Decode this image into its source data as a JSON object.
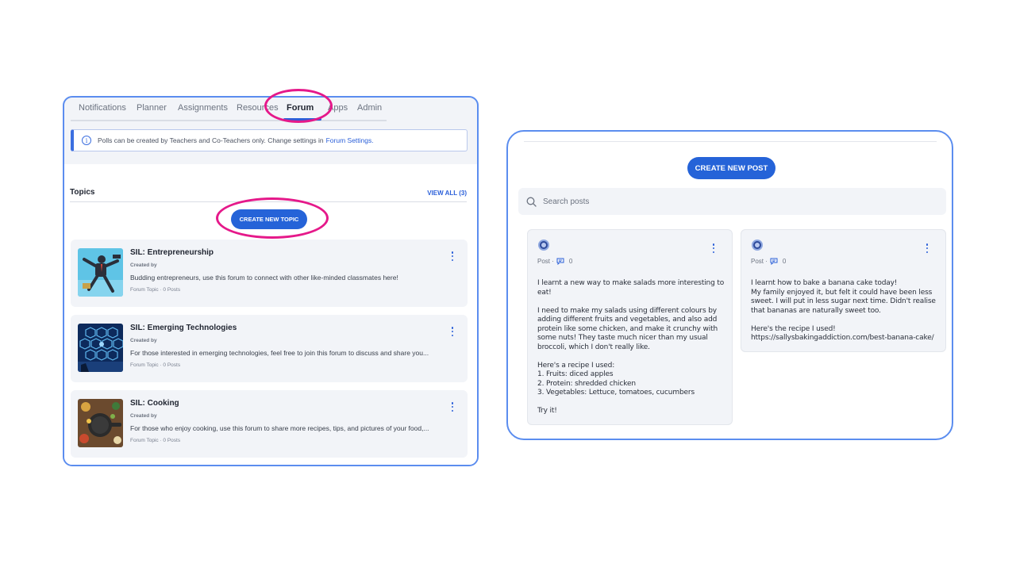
{
  "forum_panel": {
    "tabs": [
      {
        "label": "Notifications"
      },
      {
        "label": "Planner"
      },
      {
        "label": "Assignments"
      },
      {
        "label": "Resources"
      },
      {
        "label": "Forum"
      },
      {
        "label": "Apps"
      },
      {
        "label": "Admin"
      }
    ],
    "active_tab": "Forum",
    "info_banner": {
      "text": "Polls can be created by Teachers and Co-Teachers only. Change settings in",
      "link": "Forum Settings."
    },
    "topics": {
      "title": "Topics",
      "view_all": "VIEW ALL (3)",
      "create_button": "CREATE NEW TOPIC",
      "items": [
        {
          "title": "SIL: Entrepreneurship",
          "created_by": "Created by",
          "description": "Budding entrepreneurs, use this forum to connect with other like-minded classmates here!",
          "meta": "Forum Topic · 0 Posts"
        },
        {
          "title": "SIL: Emerging Technologies",
          "created_by": "Created by",
          "description": "For those interested in emerging technologies, feel free to join this forum to discuss and share you...",
          "meta": "Forum Topic · 0 Posts"
        },
        {
          "title": "SIL: Cooking",
          "created_by": "Created by",
          "description": "For those who enjoy cooking, use this forum to share more recipes, tips, and pictures of your food,...",
          "meta": "Forum Topic · 0 Posts"
        }
      ]
    }
  },
  "posts_panel": {
    "create_button": "CREATE NEW POST",
    "search_placeholder": "Search posts",
    "posts": [
      {
        "type_label": "Post ·",
        "comment_count": "0",
        "paragraphs": [
          "I learnt a new way to make salads more interesting to eat!",
          "I need to make my salads using different colours by adding different fruits and vegetables, and also add protein like some chicken, and make it crunchy with some nuts! They taste much nicer than my usual broccoli, which I don't really like.",
          "Here's a recipe I used:\n1. Fruits: diced apples\n2. Protein: shredded chicken\n3. Vegetables: Lettuce, tomatoes, cucumbers",
          "Try it!"
        ]
      },
      {
        "type_label": "Post ·",
        "comment_count": "0",
        "paragraphs": [
          "I learnt how to bake a banana cake today!\nMy family enjoyed it, but felt it could have been less sweet. I will put in less sugar next time. Didn't realise that bananas are naturally sweet too.",
          "Here's the recipe I used!\nhttps://sallysbakingaddiction.com/best-banana-cake/"
        ]
      }
    ]
  },
  "colors": {
    "accent": "#2563d8",
    "highlight_ring": "#e5198a",
    "panel_border": "#5b8def"
  },
  "icons": [
    "info-icon",
    "kebab-menu-icon",
    "search-icon",
    "comment-icon",
    "user-avatar"
  ]
}
